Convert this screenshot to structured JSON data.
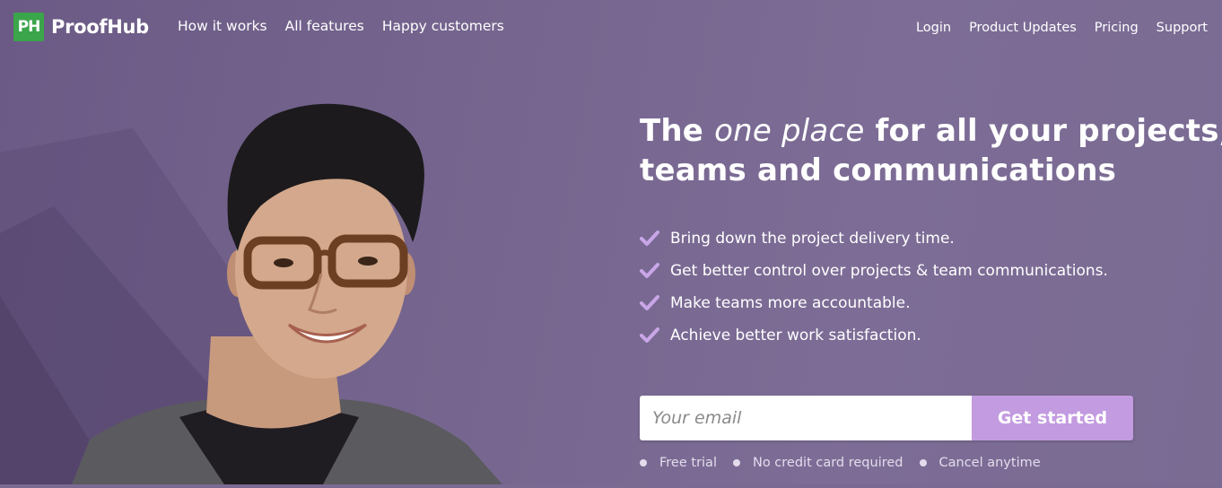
{
  "brand": {
    "logo_mark": "PH",
    "name": "ProofHub",
    "color": "#3aa54a"
  },
  "nav_left": [
    {
      "label": "How it works"
    },
    {
      "label": "All features"
    },
    {
      "label": "Happy customers"
    }
  ],
  "nav_right": [
    {
      "label": "Login"
    },
    {
      "label": "Product Updates"
    },
    {
      "label": "Pricing"
    },
    {
      "label": "Support"
    }
  ],
  "hero": {
    "headline_pre": "The ",
    "headline_em": "one place",
    "headline_post": " for all your projects, teams and communications",
    "benefits": [
      {
        "text": "Bring down the project delivery time.",
        "icon": "check-icon"
      },
      {
        "text": "Get better control over projects & team communications.",
        "icon": "check-icon"
      },
      {
        "text": "Make teams more accountable.",
        "icon": "check-icon"
      },
      {
        "text": "Achieve better work satisfaction.",
        "icon": "check-icon"
      }
    ],
    "email_placeholder": "Your email",
    "email_value": "",
    "cta_label": "Get started",
    "perks": [
      "Free trial",
      "No credit card required",
      "Cancel anytime"
    ],
    "image": "smiling-woman-with-glasses"
  },
  "colors": {
    "background": "#7a6a92",
    "cta": "#c39be0",
    "check": "#c9a6e8",
    "logo": "#3aa54a"
  }
}
